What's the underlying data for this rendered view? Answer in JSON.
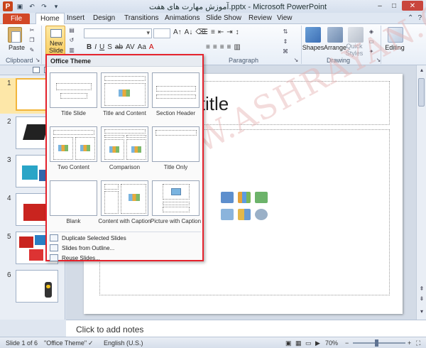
{
  "window": {
    "title": "آموزش مهارت های هفت.pptx - Microsoft PowerPoint",
    "app_logo": "P",
    "controls": [
      "–",
      "□",
      "✕"
    ]
  },
  "tabs": {
    "file": "File",
    "items": [
      "Home",
      "Insert",
      "Design",
      "Transitions",
      "Animations",
      "Slide Show",
      "Review",
      "View"
    ],
    "help": "?"
  },
  "ribbon": {
    "paste": "Paste",
    "new_slide": "New Slide",
    "groups": {
      "clipboard": "Clipboard",
      "paragraph": "Paragraph",
      "drawing": "Drawing"
    },
    "shapes": "Shapes",
    "arrange": "Arrange",
    "quick_styles": "Quick Styles",
    "editing": "Editing"
  },
  "slides_pane": {
    "numbers": [
      "1",
      "2",
      "3",
      "4",
      "5",
      "6"
    ],
    "selected_index": 1
  },
  "slide": {
    "title_placeholder": "ck to add title",
    "body_placeholder": "t",
    "watermark": "WWW.ASHRAYAN.COM"
  },
  "notes": {
    "placeholder": "Click to add notes"
  },
  "gallery": {
    "header": "Office Theme",
    "layouts": [
      "Title Slide",
      "Title and Content",
      "Section Header",
      "Two Content",
      "Comparison",
      "Title Only",
      "Blank",
      "Content with Caption",
      "Picture with Caption"
    ],
    "menu": [
      "Duplicate Selected Slides",
      "Slides from Outline...",
      "Reuse Slides..."
    ]
  },
  "status": {
    "slide_of": "Slide 1 of 6",
    "theme": "\"Office Theme\"",
    "language": "English (U.S.)",
    "zoom": "70%"
  },
  "colors": {
    "file_tab": "#d24726",
    "gallery_border": "#e5222c",
    "selected_slide": "#f2b53b"
  }
}
